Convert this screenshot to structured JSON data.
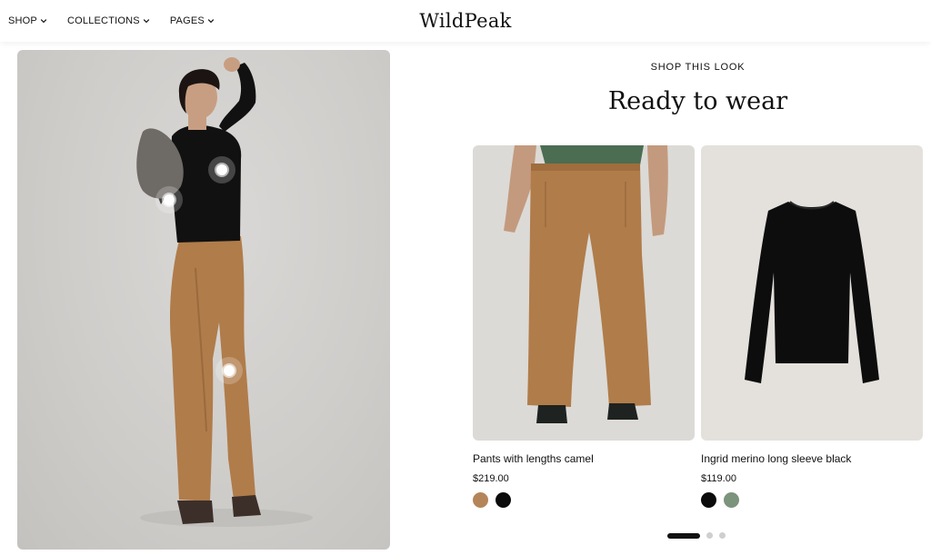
{
  "header": {
    "nav": [
      {
        "label": "SHOP"
      },
      {
        "label": "COLLECTIONS"
      },
      {
        "label": "PAGES"
      }
    ],
    "logo": "WildPeak"
  },
  "look": {
    "eyebrow": "SHOP THIS LOOK",
    "heading": "Ready to wear"
  },
  "products": [
    {
      "title": "Pants with lengths camel",
      "price": "$219.00",
      "swatches": [
        {
          "name": "camel",
          "color": "#b5855a"
        },
        {
          "name": "black",
          "color": "#0b0b0b"
        }
      ]
    },
    {
      "title": "Ingrid merino long sleeve black",
      "price": "$119.00",
      "swatches": [
        {
          "name": "black",
          "color": "#0b0b0b"
        },
        {
          "name": "sage",
          "color": "#7c937c"
        }
      ]
    }
  ],
  "carousel": {
    "page_count": 3,
    "active_index": 0
  },
  "colors": {
    "pants": "#b07c4a",
    "top": "#111111",
    "shirt_green": "#4b6d52",
    "card_bg": "#e7e5e2"
  }
}
